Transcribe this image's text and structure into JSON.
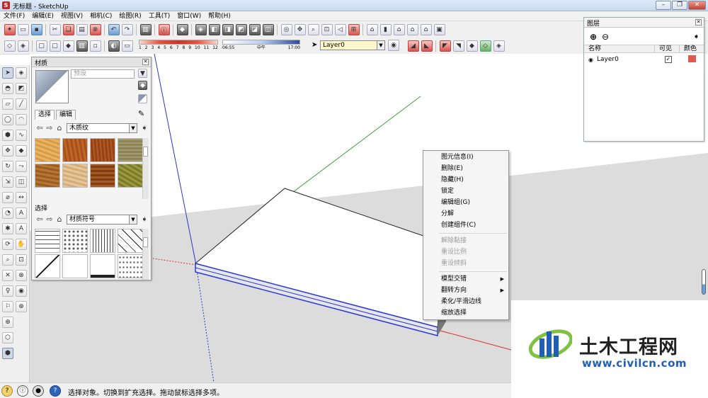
{
  "window": {
    "title": "无标题 - SketchUp",
    "controls": [
      "minimize",
      "maximize",
      "close"
    ]
  },
  "menu": [
    "文件(F)",
    "编辑(E)",
    "视图(V)",
    "相机(C)",
    "绘图(R)",
    "工具(T)",
    "窗口(W)",
    "帮助(H)"
  ],
  "shadow_toolbar": {
    "month_ticks": [
      "1",
      "2",
      "3",
      "4",
      "5",
      "6",
      "7",
      "8",
      "9",
      "10",
      "11",
      "12"
    ],
    "time_start": "06:55",
    "time_mid": "中午",
    "time_end": "17:00",
    "layer_select": "Layer0"
  },
  "materials_panel": {
    "title": "材质",
    "preset_placeholder": "预设",
    "tabs": [
      "选择",
      "编辑"
    ],
    "select1": "木质纹",
    "section2_title": "选择",
    "select2": "材质符号"
  },
  "layers_panel": {
    "title": "图层",
    "columns": [
      "名称",
      "可见",
      "颜色"
    ],
    "rows": [
      {
        "name": "Layer0",
        "visible": true,
        "color": "#e05a4f"
      }
    ]
  },
  "context_menu": {
    "group1": [
      "图元信息(I)",
      "删除(E)",
      "隐藏(H)",
      "锁定",
      "编辑组(G)",
      "分解",
      "创建组件(C)"
    ],
    "group2_disabled": [
      "解除黏接",
      "重设比例",
      "重设倾斜"
    ],
    "group3": [
      {
        "label": "模型交错",
        "submenu": true
      },
      {
        "label": "翻转方向",
        "submenu": true
      },
      {
        "label": "柔化/平滑边线",
        "submenu": false
      },
      {
        "label": "缩放选择",
        "submenu": false
      }
    ]
  },
  "status": {
    "text": "选择对象。切换到扩充选择。拖动鼠标选择多项。"
  },
  "watermark": {
    "cn": "土木工程网",
    "url": "www.civilcn.com"
  },
  "colors": {
    "accent_blue": "#1f5fb4",
    "axis_red": "#d9312b",
    "axis_green": "#3aa33a",
    "axis_blue": "#2b36c9"
  }
}
